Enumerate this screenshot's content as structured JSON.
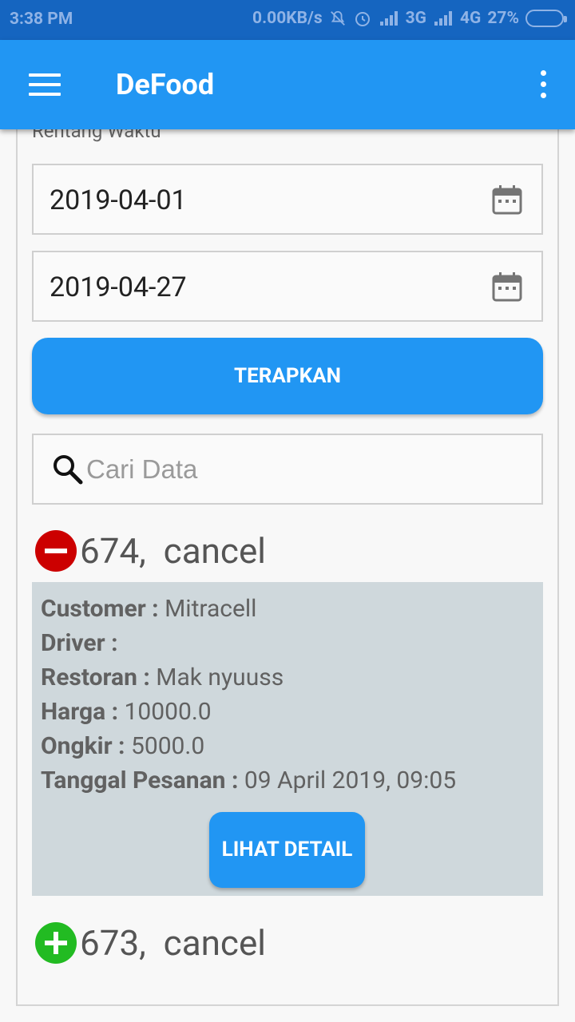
{
  "status_bar": {
    "time": "3:38 PM",
    "net_speed": "0.00KB/s",
    "network_3g": "3G",
    "network_4g": "4G",
    "battery": "27%"
  },
  "app_bar": {
    "title": "DeFood",
    "menu_icon": "hamburger-icon",
    "overflow_icon": "more-vert-icon"
  },
  "filter": {
    "label": "Rentang Waktu",
    "start_date": "2019-04-01",
    "end_date": "2019-04-27",
    "apply_label": "TERAPKAN"
  },
  "search": {
    "placeholder": "Cari Data",
    "value": ""
  },
  "orders": [
    {
      "title": "674,  cancel",
      "expanded": true,
      "icon": "minus-circle-icon",
      "icon_color": "#cc0000",
      "customer_label": "Customer : ",
      "customer": "Mitracell",
      "driver_label": "Driver : ",
      "driver": "",
      "restaurant_label": "Restoran : ",
      "restaurant": "Mak nyuuss",
      "price_label": "Harga : ",
      "price": "10000.0",
      "shipping_label": "Ongkir : ",
      "shipping": "5000.0",
      "date_label": "Tanggal Pesanan : ",
      "date": "09 April 2019, 09:05",
      "detail_label": "LIHAT DETAIL"
    },
    {
      "title": "673,  cancel",
      "expanded": false,
      "icon": "plus-circle-icon",
      "icon_color": "#22bb22"
    }
  ],
  "colors": {
    "primary": "#2196f3",
    "status_bar": "#1565c0",
    "card": "#cfd8dc"
  }
}
